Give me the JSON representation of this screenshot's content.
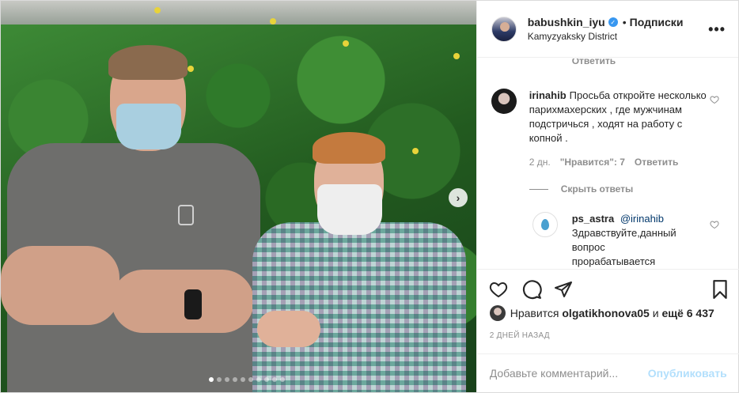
{
  "post": {
    "username": "babushkin_iyu",
    "separator": "•",
    "follow_label": "Подписки",
    "location": "Kamyzyaksky District",
    "more_label": "•••"
  },
  "carousel": {
    "slides": 10,
    "active_index": 0,
    "next_icon": "chevron-right-icon",
    "next_label": "›"
  },
  "comments": {
    "top_reply_label": "Ответить",
    "items": [
      {
        "user": "irinahib",
        "text": "Просьба откройте несколько парихмахерских , где мужчинам подстричься , ходят на работу с копной .",
        "time": "2 дн.",
        "likes": "\"Нравится\": 7",
        "reply_label": "Ответить"
      }
    ],
    "hide_replies_label": "Скрыть ответы",
    "reply": {
      "user": "ps_astra",
      "mention": "@irinahib",
      "text": "Здравствуйте,данный вопрос прорабатывается"
    }
  },
  "likes": {
    "prefix": "Нравится",
    "user": "olgatikhonova05",
    "connector": "и",
    "others": "ещё 6 437"
  },
  "date": "2 ДНЕЙ НАЗАД",
  "add_comment": {
    "placeholder": "Добавьте комментарий...",
    "publish_label": "Опубликовать"
  },
  "colors": {
    "accent": "#3897f0",
    "publish_disabled": "#b2dffc",
    "muted": "#8e8e8e"
  }
}
